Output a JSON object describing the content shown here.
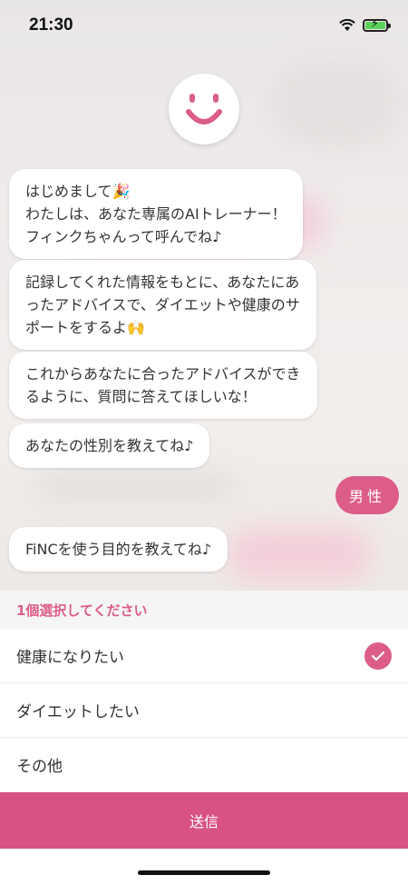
{
  "status_bar": {
    "time": "21:30",
    "battery_charging": true
  },
  "chat": {
    "bot_avatar_icon": "smiley-face-icon",
    "messages": [
      {
        "from": "bot",
        "text": "はじめまして🎉\nわたしは、あなた専属のAIトレーナー！\nフィンクちゃんって呼んでね♪"
      },
      {
        "from": "bot",
        "text": "記録してくれた情報をもとに、あなたにあ\nったアドバイスで、ダイエットや健康のサ\nポートをするよ🙌"
      },
      {
        "from": "bot",
        "text": "これからあなたに合ったアドバイスができ\nるように、質問に答えてほしいな！"
      },
      {
        "from": "bot",
        "text": "あなたの性別を教えてね♪"
      },
      {
        "from": "user",
        "text": "男性"
      },
      {
        "from": "bot",
        "text": "FiNCを使う目的を教えてね♪"
      }
    ]
  },
  "selection": {
    "header": "1個選択してください",
    "options": [
      {
        "label": "健康になりたい",
        "selected": true
      },
      {
        "label": "ダイエットしたい",
        "selected": false
      },
      {
        "label": "その他",
        "selected": false
      }
    ],
    "submit_label": "送信"
  },
  "colors": {
    "accent": "#dc5d89",
    "submit": "#d85283"
  }
}
